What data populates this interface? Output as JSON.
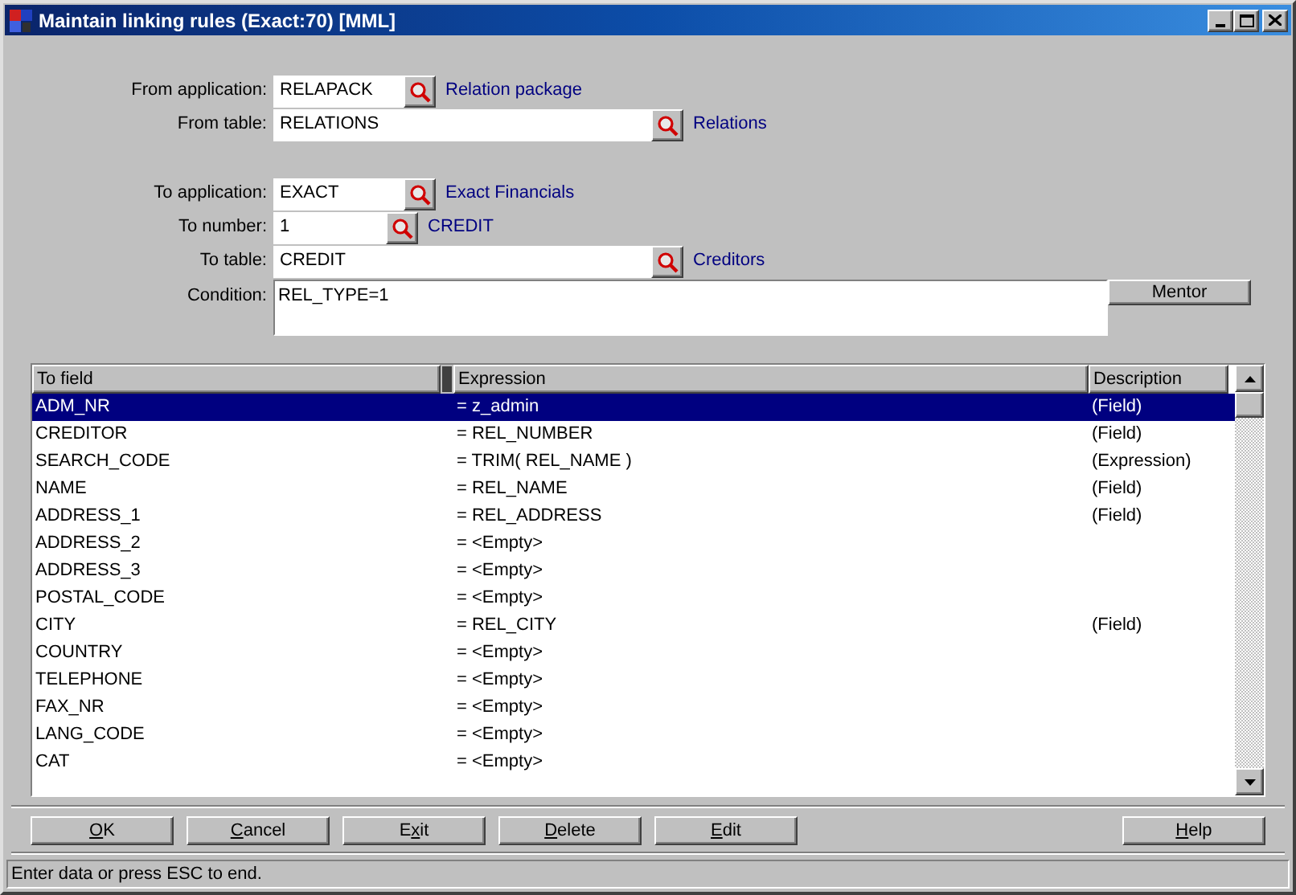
{
  "window": {
    "title": "Maintain linking rules (Exact:70) [MML]"
  },
  "from_group": [
    {
      "label": "From application:",
      "value": "RELAPACK",
      "description": "Relation package"
    },
    {
      "label": "From table:",
      "value": "RELATIONS",
      "description": "Relations"
    }
  ],
  "to_group": [
    {
      "label": "To application:",
      "value": "EXACT",
      "description": "Exact Financials"
    },
    {
      "label": "To number:",
      "value": "1",
      "description": "CREDIT"
    },
    {
      "label": "To table:",
      "value": "CREDIT",
      "description": "Creditors"
    }
  ],
  "condition": {
    "label": "Condition:",
    "value": "REL_TYPE=1",
    "button": "Mentor"
  },
  "table": {
    "columns": [
      "To field",
      "Expression",
      "Description"
    ],
    "rows": [
      {
        "to_field": "ADM_NR",
        "expression": "= z_admin",
        "description": "(Field)",
        "selected": true
      },
      {
        "to_field": "CREDITOR",
        "expression": "= REL_NUMBER",
        "description": "(Field)",
        "selected": false
      },
      {
        "to_field": "SEARCH_CODE",
        "expression": "= TRIM( REL_NAME )",
        "description": "(Expression)",
        "selected": false
      },
      {
        "to_field": "NAME",
        "expression": "= REL_NAME",
        "description": "(Field)",
        "selected": false
      },
      {
        "to_field": "ADDRESS_1",
        "expression": "= REL_ADDRESS",
        "description": "(Field)",
        "selected": false
      },
      {
        "to_field": "ADDRESS_2",
        "expression": "= <Empty>",
        "selected": false
      },
      {
        "to_field": "ADDRESS_3",
        "expression": "= <Empty>",
        "selected": false
      },
      {
        "to_field": "POSTAL_CODE",
        "expression": "= <Empty>",
        "selected": false
      },
      {
        "to_field": "CITY",
        "expression": "= REL_CITY",
        "description": "(Field)",
        "selected": false
      },
      {
        "to_field": "COUNTRY",
        "expression": "= <Empty>",
        "selected": false
      },
      {
        "to_field": "TELEPHONE",
        "expression": "= <Empty>",
        "selected": false
      },
      {
        "to_field": "FAX_NR",
        "expression": "= <Empty>",
        "selected": false
      },
      {
        "to_field": "LANG_CODE",
        "expression": "= <Empty>",
        "selected": false
      },
      {
        "to_field": "CAT",
        "expression": "= <Empty>",
        "selected": false
      }
    ]
  },
  "buttons": [
    {
      "key": "O",
      "after": "K"
    },
    {
      "key": "C",
      "after": "ancel"
    },
    {
      "before": "E",
      "key": "x",
      "after": "it"
    },
    {
      "key": "D",
      "after": "elete"
    },
    {
      "key": "E",
      "after": "dit"
    }
  ],
  "help_button": {
    "key": "H",
    "after": "elp"
  },
  "status_bar": "Enter data or press ESC to end."
}
